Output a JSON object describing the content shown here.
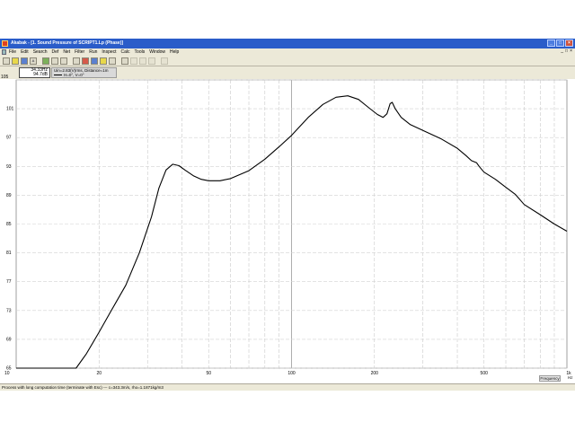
{
  "window": {
    "app_icon": "app-logo-icon",
    "title": "Akabak - [1. Sound Pressure of SCRIPT1.Lp (Phase)]",
    "buttons": [
      "_",
      "□",
      "×"
    ]
  },
  "menu": {
    "items": [
      "File",
      "Edit",
      "Search",
      "Def",
      "Net",
      "Filter",
      "Run",
      "Inspect",
      "Calc",
      "Tools",
      "Window",
      "Help"
    ],
    "mdi_buttons": [
      "_",
      "□",
      "×"
    ]
  },
  "toolbar": {
    "buttons": [
      {
        "icon": "new-icon",
        "text": "",
        "style": "",
        "gap": false
      },
      {
        "icon": "open-icon",
        "text": "",
        "style": "yellow",
        "gap": false
      },
      {
        "icon": "save-icon",
        "text": "",
        "style": "blue",
        "gap": false
      },
      {
        "icon": "font-icon",
        "text": "A",
        "style": "",
        "gap": false
      },
      {
        "icon": "run-icon",
        "text": "",
        "style": "green",
        "gap": true
      },
      {
        "icon": "grid-icon",
        "text": "",
        "style": "",
        "gap": false
      },
      {
        "icon": "copy-icon",
        "text": "",
        "style": "",
        "gap": false
      },
      {
        "icon": "curve-icon",
        "text": "",
        "style": "",
        "gap": true
      },
      {
        "icon": "record-icon",
        "text": "",
        "style": "red",
        "gap": false
      },
      {
        "icon": "pressure-icon",
        "text": "",
        "style": "blue",
        "gap": false
      },
      {
        "icon": "dialog-icon",
        "text": "",
        "style": "yellow",
        "gap": false
      },
      {
        "icon": "marker-icon",
        "text": "",
        "style": "",
        "gap": false
      },
      {
        "icon": "zoom-in-icon",
        "text": "",
        "style": "",
        "gap": true
      },
      {
        "icon": "zoom-out-icon",
        "text": "",
        "style": "dim",
        "gap": false
      },
      {
        "icon": "scroll-left-icon",
        "text": "",
        "style": "dim",
        "gap": false
      },
      {
        "icon": "scroll-right-icon",
        "text": "",
        "style": "dim",
        "gap": false
      },
      {
        "icon": "fit-icon",
        "text": "",
        "style": "dim",
        "gap": true
      }
    ]
  },
  "readout": {
    "line1": "34.33Hz",
    "line2": "94.7dB"
  },
  "legend": {
    "line1": "Uin=2.83(V)rms, Distance=1m",
    "line2": "H=0°, V=0°"
  },
  "plot": {
    "ylabel": "105",
    "x_axis_label": "Frequency",
    "x_unit": "Hz"
  },
  "chart_data": {
    "type": "line",
    "x_scale": "log",
    "xlim": [
      10,
      1000
    ],
    "ylim": [
      65,
      105
    ],
    "ylabel": "",
    "x_ticks": [
      {
        "value": 10,
        "label": "10"
      },
      {
        "value": 20,
        "label": "20"
      },
      {
        "value": 50,
        "label": "50"
      },
      {
        "value": 100,
        "label": "100"
      },
      {
        "value": 200,
        "label": "200"
      },
      {
        "value": 500,
        "label": "500"
      },
      {
        "value": 1000,
        "label": "1k"
      }
    ],
    "y_ticks": [
      {
        "value": 105,
        "label": "105"
      },
      {
        "value": 101,
        "label": "101"
      },
      {
        "value": 97,
        "label": "97"
      },
      {
        "value": 93,
        "label": "93"
      },
      {
        "value": 89,
        "label": "89"
      },
      {
        "value": 85,
        "label": "85"
      },
      {
        "value": 81,
        "label": "81"
      },
      {
        "value": 77,
        "label": "77"
      },
      {
        "value": 73,
        "label": "73"
      },
      {
        "value": 69,
        "label": "69"
      },
      {
        "value": 65,
        "label": "65"
      }
    ],
    "grid": true,
    "series": [
      {
        "color": "#000000",
        "points": [
          [
            10,
            65
          ],
          [
            16.5,
            65
          ],
          [
            18,
            67
          ],
          [
            20,
            70
          ],
          [
            22,
            72.8
          ],
          [
            25,
            76.5
          ],
          [
            28,
            81
          ],
          [
            31,
            86
          ],
          [
            33,
            90
          ],
          [
            35,
            92.5
          ],
          [
            37,
            93.3
          ],
          [
            39,
            93.1
          ],
          [
            41,
            92.5
          ],
          [
            44,
            91.7
          ],
          [
            47,
            91.2
          ],
          [
            50,
            91
          ],
          [
            55,
            91
          ],
          [
            60,
            91.3
          ],
          [
            70,
            92.4
          ],
          [
            80,
            94
          ],
          [
            90,
            95.7
          ],
          [
            100,
            97.3
          ],
          [
            115,
            99.8
          ],
          [
            130,
            101.6
          ],
          [
            145,
            102.6
          ],
          [
            160,
            102.8
          ],
          [
            175,
            102.3
          ],
          [
            190,
            101.2
          ],
          [
            205,
            100.2
          ],
          [
            215,
            99.8
          ],
          [
            222,
            100.3
          ],
          [
            228,
            101.7
          ],
          [
            232,
            101.9
          ],
          [
            238,
            101
          ],
          [
            250,
            99.8
          ],
          [
            270,
            98.8
          ],
          [
            300,
            98
          ],
          [
            350,
            96.8
          ],
          [
            400,
            95.5
          ],
          [
            430,
            94.5
          ],
          [
            450,
            93.8
          ],
          [
            470,
            93.5
          ],
          [
            480,
            93
          ],
          [
            500,
            92.2
          ],
          [
            550,
            91.2
          ],
          [
            600,
            90.1
          ],
          [
            650,
            89.1
          ],
          [
            700,
            87.7
          ],
          [
            800,
            86.3
          ],
          [
            900,
            85
          ],
          [
            1000,
            84
          ]
        ]
      }
    ]
  },
  "status": {
    "text": "Process with long computation time (terminate with Esc) --- c=343.3m/s, rho=1.1871kg/m3"
  }
}
